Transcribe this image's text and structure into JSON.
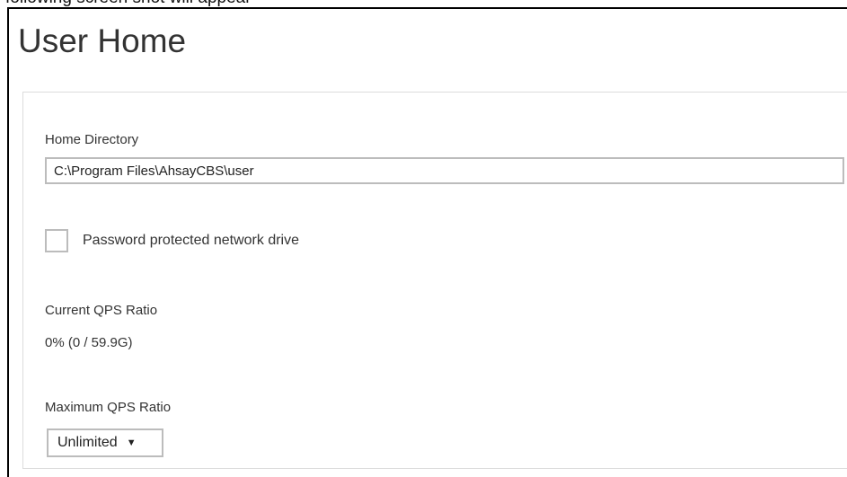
{
  "caption": "following screen shot will appear",
  "page": {
    "title": "User Home"
  },
  "home_directory": {
    "label": "Home Directory",
    "value": "C:\\Program Files\\AhsayCBS\\user"
  },
  "network_drive": {
    "label": "Password protected network drive",
    "checked": false
  },
  "current_qps": {
    "label": "Current QPS Ratio",
    "value": "0% (0 / 59.9G)"
  },
  "maximum_qps": {
    "label": "Maximum QPS Ratio",
    "selected": "Unlimited",
    "arrow_icon": "dropdown-triangle-icon"
  }
}
